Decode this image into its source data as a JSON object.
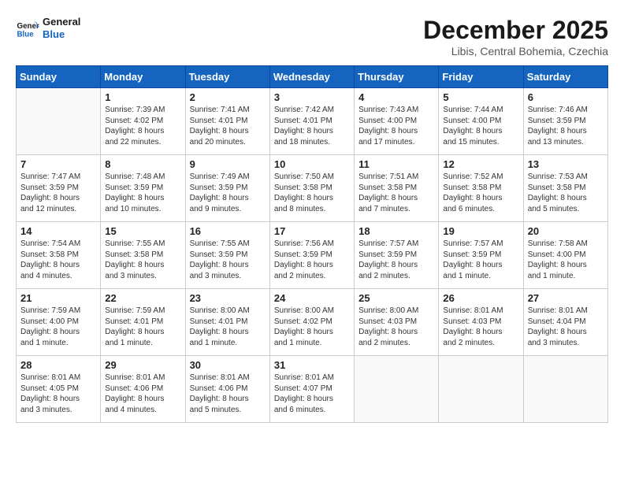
{
  "header": {
    "logo_general": "General",
    "logo_blue": "Blue",
    "month": "December 2025",
    "location": "Libis, Central Bohemia, Czechia"
  },
  "days_of_week": [
    "Sunday",
    "Monday",
    "Tuesday",
    "Wednesday",
    "Thursday",
    "Friday",
    "Saturday"
  ],
  "weeks": [
    [
      {
        "day": null,
        "info": null
      },
      {
        "day": "1",
        "info": "Sunrise: 7:39 AM\nSunset: 4:02 PM\nDaylight: 8 hours\nand 22 minutes."
      },
      {
        "day": "2",
        "info": "Sunrise: 7:41 AM\nSunset: 4:01 PM\nDaylight: 8 hours\nand 20 minutes."
      },
      {
        "day": "3",
        "info": "Sunrise: 7:42 AM\nSunset: 4:01 PM\nDaylight: 8 hours\nand 18 minutes."
      },
      {
        "day": "4",
        "info": "Sunrise: 7:43 AM\nSunset: 4:00 PM\nDaylight: 8 hours\nand 17 minutes."
      },
      {
        "day": "5",
        "info": "Sunrise: 7:44 AM\nSunset: 4:00 PM\nDaylight: 8 hours\nand 15 minutes."
      },
      {
        "day": "6",
        "info": "Sunrise: 7:46 AM\nSunset: 3:59 PM\nDaylight: 8 hours\nand 13 minutes."
      }
    ],
    [
      {
        "day": "7",
        "info": "Sunrise: 7:47 AM\nSunset: 3:59 PM\nDaylight: 8 hours\nand 12 minutes."
      },
      {
        "day": "8",
        "info": "Sunrise: 7:48 AM\nSunset: 3:59 PM\nDaylight: 8 hours\nand 10 minutes."
      },
      {
        "day": "9",
        "info": "Sunrise: 7:49 AM\nSunset: 3:59 PM\nDaylight: 8 hours\nand 9 minutes."
      },
      {
        "day": "10",
        "info": "Sunrise: 7:50 AM\nSunset: 3:58 PM\nDaylight: 8 hours\nand 8 minutes."
      },
      {
        "day": "11",
        "info": "Sunrise: 7:51 AM\nSunset: 3:58 PM\nDaylight: 8 hours\nand 7 minutes."
      },
      {
        "day": "12",
        "info": "Sunrise: 7:52 AM\nSunset: 3:58 PM\nDaylight: 8 hours\nand 6 minutes."
      },
      {
        "day": "13",
        "info": "Sunrise: 7:53 AM\nSunset: 3:58 PM\nDaylight: 8 hours\nand 5 minutes."
      }
    ],
    [
      {
        "day": "14",
        "info": "Sunrise: 7:54 AM\nSunset: 3:58 PM\nDaylight: 8 hours\nand 4 minutes."
      },
      {
        "day": "15",
        "info": "Sunrise: 7:55 AM\nSunset: 3:58 PM\nDaylight: 8 hours\nand 3 minutes."
      },
      {
        "day": "16",
        "info": "Sunrise: 7:55 AM\nSunset: 3:59 PM\nDaylight: 8 hours\nand 3 minutes."
      },
      {
        "day": "17",
        "info": "Sunrise: 7:56 AM\nSunset: 3:59 PM\nDaylight: 8 hours\nand 2 minutes."
      },
      {
        "day": "18",
        "info": "Sunrise: 7:57 AM\nSunset: 3:59 PM\nDaylight: 8 hours\nand 2 minutes."
      },
      {
        "day": "19",
        "info": "Sunrise: 7:57 AM\nSunset: 3:59 PM\nDaylight: 8 hours\nand 1 minute."
      },
      {
        "day": "20",
        "info": "Sunrise: 7:58 AM\nSunset: 4:00 PM\nDaylight: 8 hours\nand 1 minute."
      }
    ],
    [
      {
        "day": "21",
        "info": "Sunrise: 7:59 AM\nSunset: 4:00 PM\nDaylight: 8 hours\nand 1 minute."
      },
      {
        "day": "22",
        "info": "Sunrise: 7:59 AM\nSunset: 4:01 PM\nDaylight: 8 hours\nand 1 minute."
      },
      {
        "day": "23",
        "info": "Sunrise: 8:00 AM\nSunset: 4:01 PM\nDaylight: 8 hours\nand 1 minute."
      },
      {
        "day": "24",
        "info": "Sunrise: 8:00 AM\nSunset: 4:02 PM\nDaylight: 8 hours\nand 1 minute."
      },
      {
        "day": "25",
        "info": "Sunrise: 8:00 AM\nSunset: 4:03 PM\nDaylight: 8 hours\nand 2 minutes."
      },
      {
        "day": "26",
        "info": "Sunrise: 8:01 AM\nSunset: 4:03 PM\nDaylight: 8 hours\nand 2 minutes."
      },
      {
        "day": "27",
        "info": "Sunrise: 8:01 AM\nSunset: 4:04 PM\nDaylight: 8 hours\nand 3 minutes."
      }
    ],
    [
      {
        "day": "28",
        "info": "Sunrise: 8:01 AM\nSunset: 4:05 PM\nDaylight: 8 hours\nand 3 minutes."
      },
      {
        "day": "29",
        "info": "Sunrise: 8:01 AM\nSunset: 4:06 PM\nDaylight: 8 hours\nand 4 minutes."
      },
      {
        "day": "30",
        "info": "Sunrise: 8:01 AM\nSunset: 4:06 PM\nDaylight: 8 hours\nand 5 minutes."
      },
      {
        "day": "31",
        "info": "Sunrise: 8:01 AM\nSunset: 4:07 PM\nDaylight: 8 hours\nand 6 minutes."
      },
      {
        "day": null,
        "info": null
      },
      {
        "day": null,
        "info": null
      },
      {
        "day": null,
        "info": null
      }
    ]
  ]
}
